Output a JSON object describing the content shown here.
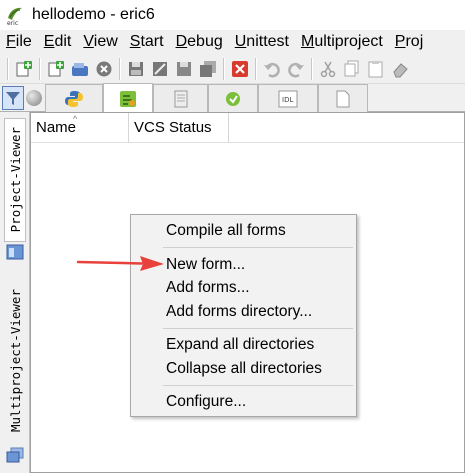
{
  "window": {
    "title": "hellodemo - eric6",
    "app_icon": "eric-logo"
  },
  "menubar": [
    {
      "label": "File",
      "accel": "F",
      "rest": "ile"
    },
    {
      "label": "Edit",
      "accel": "E",
      "rest": "dit"
    },
    {
      "label": "View",
      "accel": "V",
      "rest": "iew"
    },
    {
      "label": "Start",
      "accel": "S",
      "rest": "tart"
    },
    {
      "label": "Debug",
      "accel": "D",
      "rest": "ebug"
    },
    {
      "label": "Unittest",
      "accel": "U",
      "rest": "nittest"
    },
    {
      "label": "Multiproject",
      "accel": "M",
      "rest": "ultiproject"
    },
    {
      "label": "Proj",
      "accel": "P",
      "rest": "roj"
    }
  ],
  "sidebar": {
    "tab1": "Project-Viewer",
    "tab2": "Multiproject-Viewer"
  },
  "table": {
    "col_name": "Name",
    "col_vcs": "VCS Status"
  },
  "context_menu": {
    "compile_all": "Compile all forms",
    "new_form": "New form...",
    "add_forms": "Add forms...",
    "add_dir": "Add forms directory...",
    "expand": "Expand all directories",
    "collapse": "Collapse all directories",
    "configure": "Configure..."
  },
  "colors": {
    "arrow": "#e8403a",
    "accent": "#5a7db5"
  }
}
